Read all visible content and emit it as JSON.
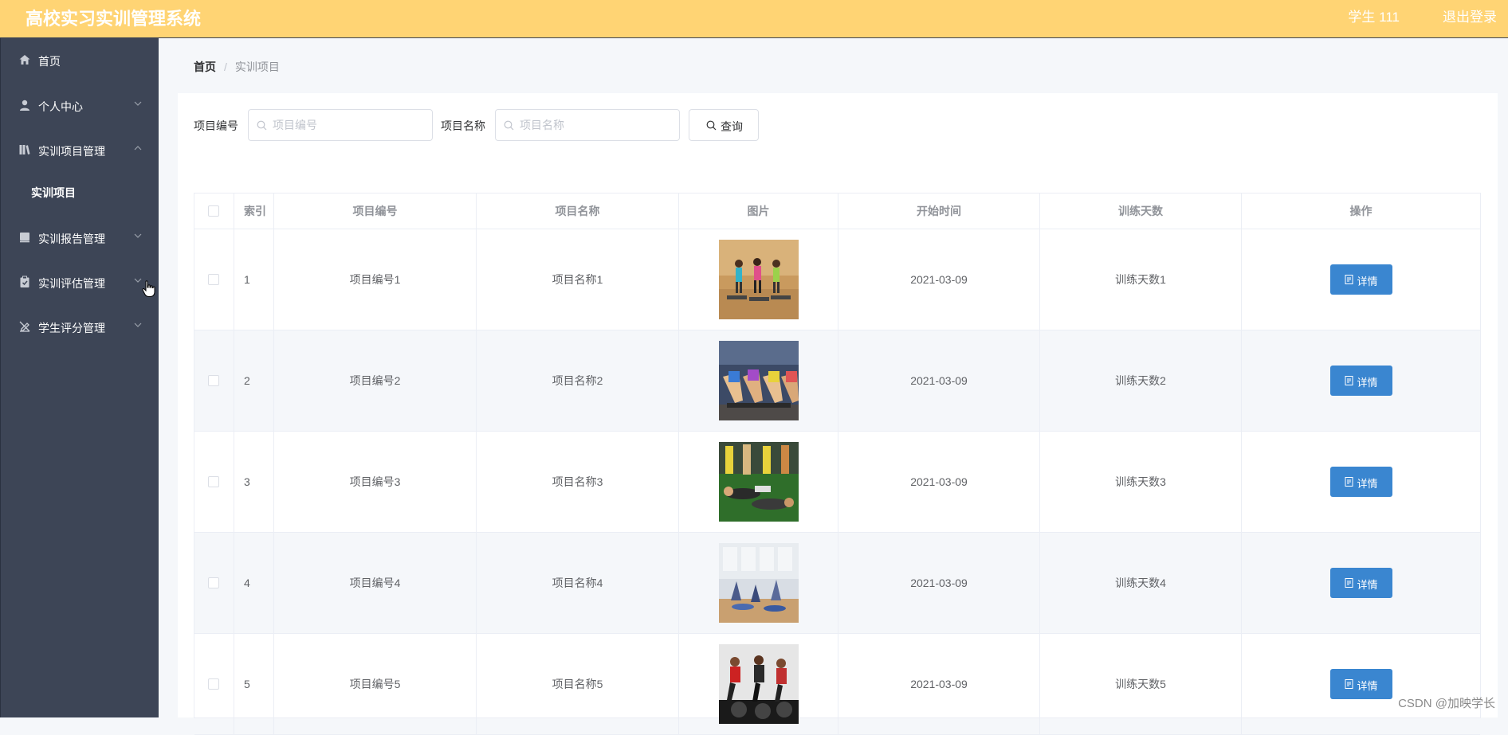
{
  "header": {
    "title": "高校实习实训管理系统",
    "user": "学生 111",
    "logout": "退出登录"
  },
  "sidebar": {
    "items": [
      {
        "label": "首页",
        "icon": "home-icon",
        "has_arrow": false
      },
      {
        "label": "个人中心",
        "icon": "user-icon",
        "has_arrow": true,
        "arrow": "down"
      },
      {
        "label": "实训项目管理",
        "icon": "library-icon",
        "has_arrow": true,
        "arrow": "up"
      },
      {
        "label": "实训报告管理",
        "icon": "report-icon",
        "has_arrow": true,
        "arrow": "down"
      },
      {
        "label": "实训评估管理",
        "icon": "clipboard-icon",
        "has_arrow": true,
        "arrow": "down"
      },
      {
        "label": "学生评分管理",
        "icon": "rating-icon",
        "has_arrow": true,
        "arrow": "down"
      }
    ],
    "submenu": {
      "label": "实训项目"
    }
  },
  "breadcrumb": {
    "home": "首页",
    "separator": "/",
    "current": "实训项目"
  },
  "search": {
    "code_label": "项目编号",
    "code_placeholder": "项目编号",
    "name_label": "项目名称",
    "name_placeholder": "项目名称",
    "query_label": "查询"
  },
  "table": {
    "columns": [
      "索引",
      "项目编号",
      "项目名称",
      "图片",
      "开始时间",
      "训练天数",
      "操作"
    ],
    "detail_label": "详情",
    "rows": [
      {
        "index": "1",
        "code": "项目编号1",
        "name": "项目名称1",
        "start": "2021-03-09",
        "days": "训练天数1"
      },
      {
        "index": "2",
        "code": "项目编号2",
        "name": "项目名称2",
        "start": "2021-03-09",
        "days": "训练天数2"
      },
      {
        "index": "3",
        "code": "项目编号3",
        "name": "项目名称3",
        "start": "2021-03-09",
        "days": "训练天数3"
      },
      {
        "index": "4",
        "code": "项目编号4",
        "name": "项目名称4",
        "start": "2021-03-09",
        "days": "训练天数4"
      },
      {
        "index": "5",
        "code": "项目编号5",
        "name": "项目名称5",
        "start": "2021-03-09",
        "days": "训练天数5"
      }
    ]
  },
  "watermark": "CSDN @加映学长",
  "colors": {
    "header_bg": "#ffd474",
    "sidebar_bg": "#3d4556",
    "detail_button": "#3a86d0"
  }
}
